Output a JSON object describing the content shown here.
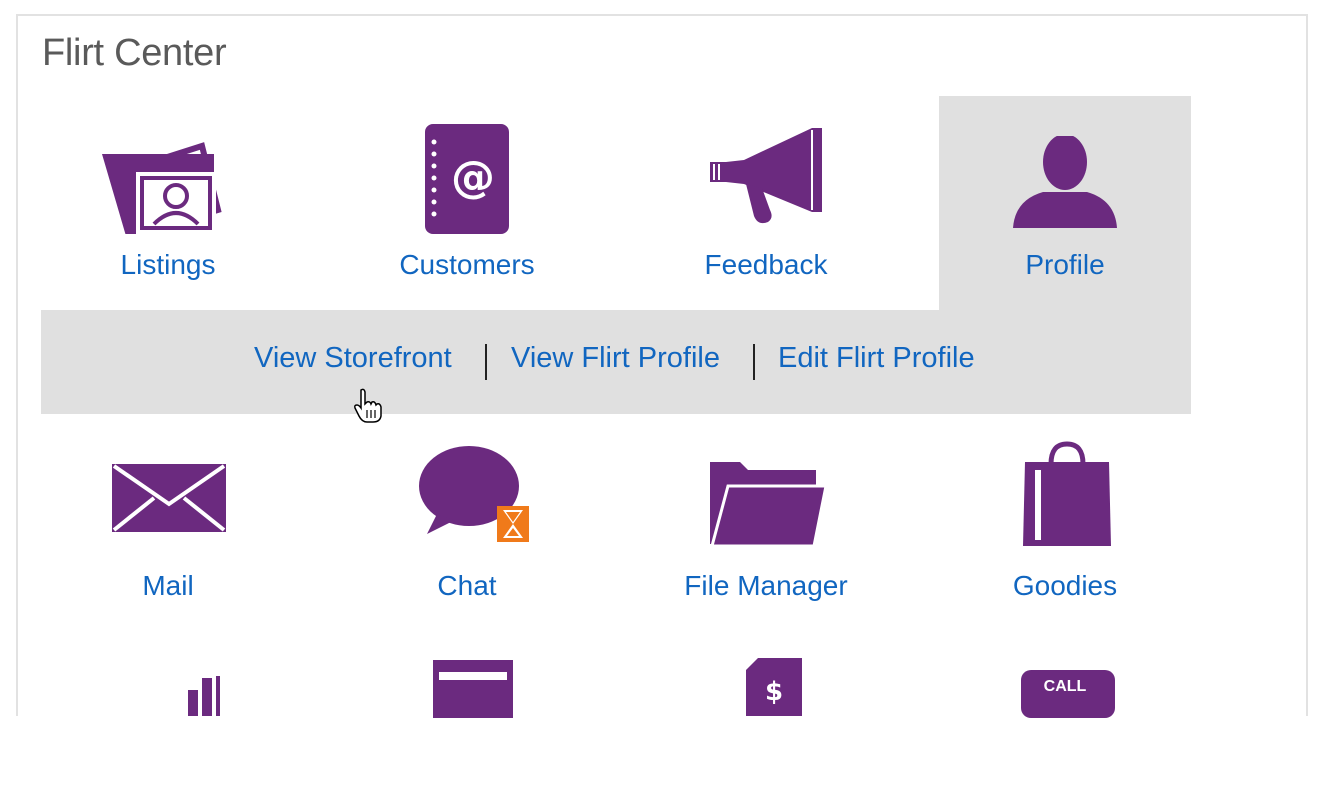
{
  "panel": {
    "title": "Flirt Center"
  },
  "tiles_row1": [
    {
      "id": "listings",
      "label": "Listings",
      "icon": "listings-photos-icon"
    },
    {
      "id": "customers",
      "label": "Customers",
      "icon": "address-book-icon"
    },
    {
      "id": "feedback",
      "label": "Feedback",
      "icon": "megaphone-icon"
    },
    {
      "id": "profile",
      "label": "Profile",
      "icon": "person-icon",
      "selected": true
    }
  ],
  "profile_submenu": [
    {
      "label": "View Storefront"
    },
    {
      "label": "View Flirt Profile"
    },
    {
      "label": "Edit Flirt Profile"
    }
  ],
  "tiles_row2": [
    {
      "id": "mail",
      "label": "Mail",
      "icon": "envelope-icon"
    },
    {
      "id": "chat",
      "label": "Chat",
      "icon": "chat-bubble-hourglass-icon"
    },
    {
      "id": "file-manager",
      "label": "File Manager",
      "icon": "folder-icon"
    },
    {
      "id": "goodies",
      "label": "Goodies",
      "icon": "shopping-bag-icon"
    }
  ],
  "tiles_row3_partial": [
    {
      "icon": "bar-chart-icon"
    },
    {
      "icon": "card-icon"
    },
    {
      "icon": "invoice-dollar-icon"
    },
    {
      "icon": "call-button-icon",
      "text": "CALL"
    }
  ],
  "colors": {
    "purple": "#6b2a7f",
    "link": "#1166c0",
    "highlight": "#e0e0e0",
    "orange": "#f07a1a"
  }
}
